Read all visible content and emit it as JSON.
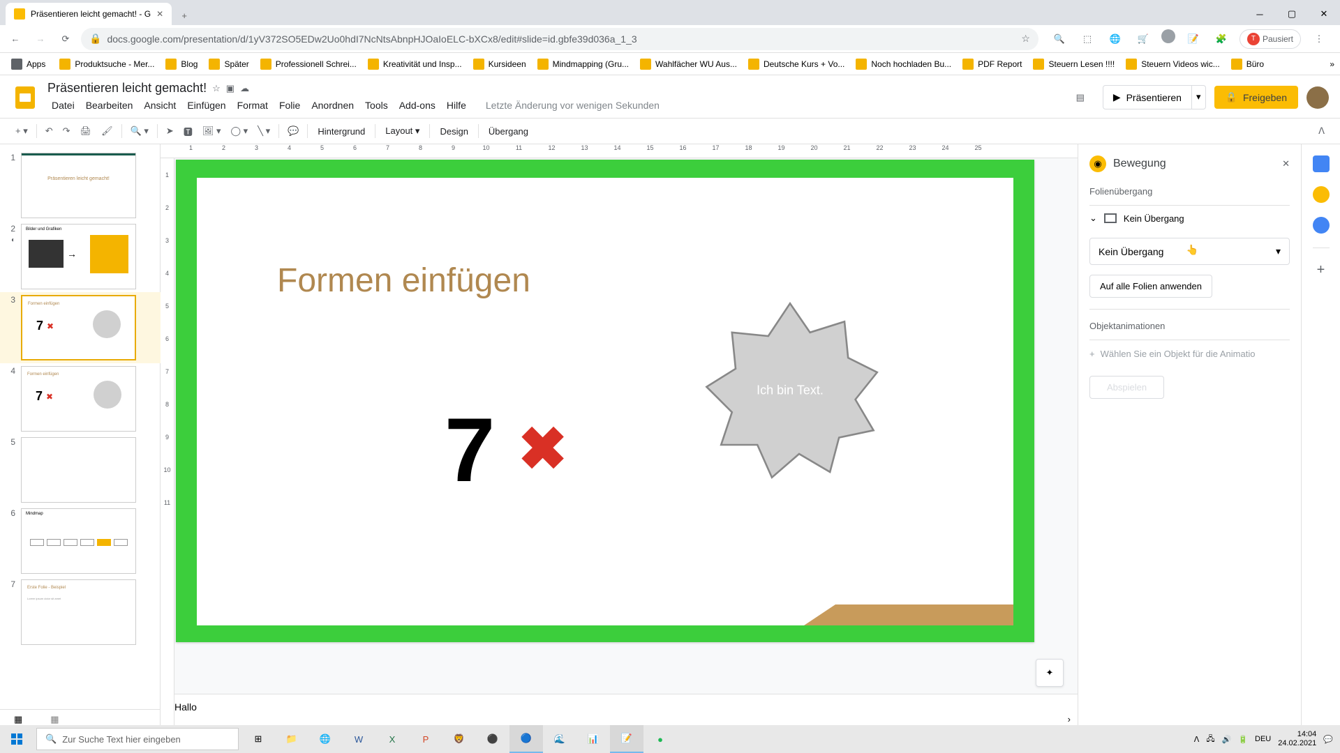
{
  "browser": {
    "tab_title": "Präsentieren leicht gemacht! - G",
    "url": "docs.google.com/presentation/d/1yV372SO5EDw2Uo0hdI7NcNtsAbnpHJOaIoELC-bXCx8/edit#slide=id.gbfe39d036a_1_3",
    "pause_label": "Pausiert"
  },
  "bookmarks": {
    "apps": "Apps",
    "items": [
      "Produktsuche - Mer...",
      "Blog",
      "Später",
      "Professionell Schrei...",
      "Kreativität und Insp...",
      "Kursideen",
      "Mindmapping  (Gru...",
      "Wahlfächer WU Aus...",
      "Deutsche Kurs + Vo...",
      "Noch hochladen Bu...",
      "PDF Report",
      "Steuern Lesen !!!!",
      "Steuern Videos wic...",
      "Büro"
    ]
  },
  "doc": {
    "title": "Präsentieren leicht gemacht!",
    "menus": [
      "Datei",
      "Bearbeiten",
      "Ansicht",
      "Einfügen",
      "Format",
      "Folie",
      "Anordnen",
      "Tools",
      "Add-ons",
      "Hilfe"
    ],
    "last_edit": "Letzte Änderung vor wenigen Sekunden",
    "present": "Präsentieren",
    "share": "Freigeben"
  },
  "toolbar": {
    "background": "Hintergrund",
    "layout": "Layout",
    "design": "Design",
    "transition": "Übergang"
  },
  "ruler_h": [
    "1",
    "2",
    "3",
    "4",
    "5",
    "6",
    "7",
    "8",
    "9",
    "10",
    "11",
    "12",
    "13",
    "14",
    "15",
    "16",
    "17",
    "18",
    "19",
    "20",
    "21",
    "22",
    "23",
    "24",
    "25"
  ],
  "ruler_v": [
    "1",
    "2",
    "3",
    "4",
    "5",
    "6",
    "7",
    "8",
    "9",
    "10",
    "11"
  ],
  "slides": {
    "numbers": [
      "1",
      "2",
      "3",
      "4",
      "5",
      "6",
      "7"
    ]
  },
  "slide": {
    "title": "Formen einfügen",
    "seven": "7",
    "x": "✖",
    "star_text": "Ich bin Text."
  },
  "notes": "Hallo",
  "panel": {
    "title": "Bewegung",
    "section_transition": "Folienübergang",
    "no_transition": "Kein Übergang",
    "dropdown": "Kein Übergang",
    "apply_all": "Auf alle Folien anwenden",
    "section_anim": "Objektanimationen",
    "add_anim": "Wählen Sie ein Objekt für die Animatio",
    "play": "Abspielen"
  },
  "taskbar": {
    "search_placeholder": "Zur Suche Text hier eingeben",
    "lang": "DEU",
    "time": "14:04",
    "date": "24.02.2021"
  }
}
